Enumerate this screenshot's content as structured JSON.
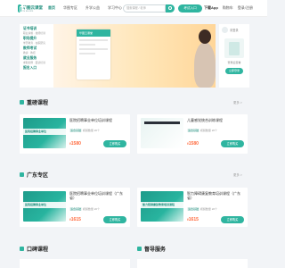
{
  "logo": {
    "name": "华图云课堂",
    "tagline": "huatu.com"
  },
  "nav": [
    "首页",
    "华图专区",
    "升学公益",
    "学习中心",
    "公益直播"
  ],
  "search": {
    "placeholder": "搜索课程 / 老师"
  },
  "exam_button": "考试入口",
  "top_links": [
    "下载App",
    "购物车",
    "登录/注册"
  ],
  "side_menu": [
    {
      "title": "证书培训",
      "sub": "职业资格 · 技能培训"
    },
    {
      "title": "职场提升",
      "sub": "学历教育 · 在职研究"
    },
    {
      "title": "教师考试",
      "sub": "教资 · 教招"
    },
    {
      "title": "就业服务",
      "sub": "求职指导 · 面试培训"
    },
    {
      "title": "报名入口",
      "sub": ""
    }
  ],
  "banner": {
    "card_brand": "华图云课堂"
  },
  "user_panel": {
    "name": "未登录",
    "text": "登录后查看",
    "button": "立即登录"
  },
  "sections": [
    {
      "title": "重磅课程",
      "more": "更多 >"
    },
    {
      "title": "广东专区",
      "more": "更多 >"
    },
    {
      "title": "口碑课程",
      "more": "更多 >"
    },
    {
      "title": "督导服务",
      "more": "更多 >"
    }
  ],
  "courses": [
    {
      "thumb_text": "医院招聘事业单位",
      "title": "医院招聘事业单位培训课程",
      "tags": "适合基础",
      "meta": "视频数量 20个",
      "price": "1580",
      "currency": "¥",
      "buy": "立即购买"
    },
    {
      "thumb_text": "",
      "title": "儿童感觉统合训练课程",
      "tags": "适合基础",
      "meta": "视频数量 20个",
      "price": "1580",
      "currency": "¥",
      "buy": "立即购买"
    },
    {
      "thumb_text": "医院招聘事业单位",
      "title": "医院招聘事业单位培训课程（广东省）",
      "tags": "适合基础",
      "meta": "视频数量 20个",
      "price": "1615",
      "currency": "¥",
      "buy": "立即购买"
    },
    {
      "thumb_text": "智力障碍康复教育培训课程",
      "title": "智力障碍康复教育培训课程（广东省）",
      "tags": "适合基础",
      "meta": "视频数量 20个",
      "price": "1615",
      "currency": "¥",
      "buy": "立即购买"
    }
  ],
  "colors": {
    "accent": "#2fb5a0",
    "price": "#ff6a3d"
  }
}
